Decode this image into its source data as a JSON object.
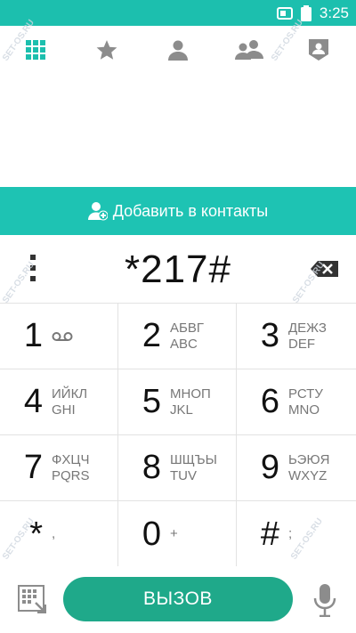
{
  "status_bar": {
    "time": "3:25",
    "battery_icon": "battery-icon",
    "sim_icon": "sim-icon"
  },
  "tabs": [
    {
      "name": "dialpad",
      "icon": "dialpad-grid-icon",
      "active": true
    },
    {
      "name": "favorites",
      "icon": "star-icon"
    },
    {
      "name": "contacts",
      "icon": "person-icon"
    },
    {
      "name": "groups",
      "icon": "people-icon"
    },
    {
      "name": "profile",
      "icon": "shield-person-icon"
    }
  ],
  "add_contact": {
    "label": "Добавить в контакты",
    "icon": "add-person-icon"
  },
  "dialed_number": "*217#",
  "keypad": [
    {
      "digit": "1",
      "line1": "",
      "line2": "",
      "icon": "voicemail-icon"
    },
    {
      "digit": "2",
      "line1": "АБВГ",
      "line2": "ABC"
    },
    {
      "digit": "3",
      "line1": "ДЕЖЗ",
      "line2": "DEF"
    },
    {
      "digit": "4",
      "line1": "ИЙКЛ",
      "line2": "GHI"
    },
    {
      "digit": "5",
      "line1": "МНОП",
      "line2": "JKL"
    },
    {
      "digit": "6",
      "line1": "РСТУ",
      "line2": "MNO"
    },
    {
      "digit": "7",
      "line1": "ФХЦЧ",
      "line2": "PQRS"
    },
    {
      "digit": "8",
      "line1": "ШЩЪЫ",
      "line2": "TUV"
    },
    {
      "digit": "9",
      "line1": "ЬЭЮЯ",
      "line2": "WXYZ"
    },
    {
      "digit": "*",
      "line1": ",",
      "line2": ""
    },
    {
      "digit": "0",
      "line1": "+",
      "line2": ""
    },
    {
      "digit": "#",
      "line1": ";",
      "line2": ""
    }
  ],
  "call_button": {
    "label": "ВЫЗОВ"
  },
  "watermark": "SET-OS.RU",
  "colors": {
    "accent": "#1cbfae",
    "call": "#1fa98a",
    "icon_gray": "#8c8c8c"
  }
}
